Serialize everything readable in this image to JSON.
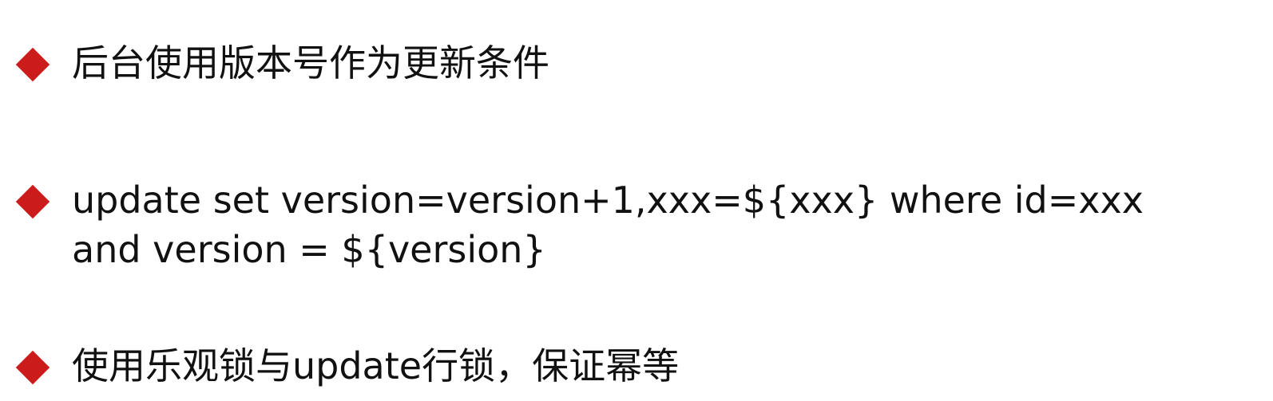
{
  "bullets": [
    {
      "lines": [
        "后台使用版本号作为更新条件"
      ]
    },
    {
      "lines": [
        "update set version=version+1,xxx=${xxx} where id=xxx",
        "and version = ${version}"
      ]
    },
    {
      "lines": [
        "使用乐观锁与update行锁，保证幂等"
      ]
    }
  ],
  "colors": {
    "marker": "#cc1b1b",
    "text": "#111111",
    "background": "#ffffff"
  },
  "icons": {
    "marker": "diamond-bullet-icon"
  }
}
